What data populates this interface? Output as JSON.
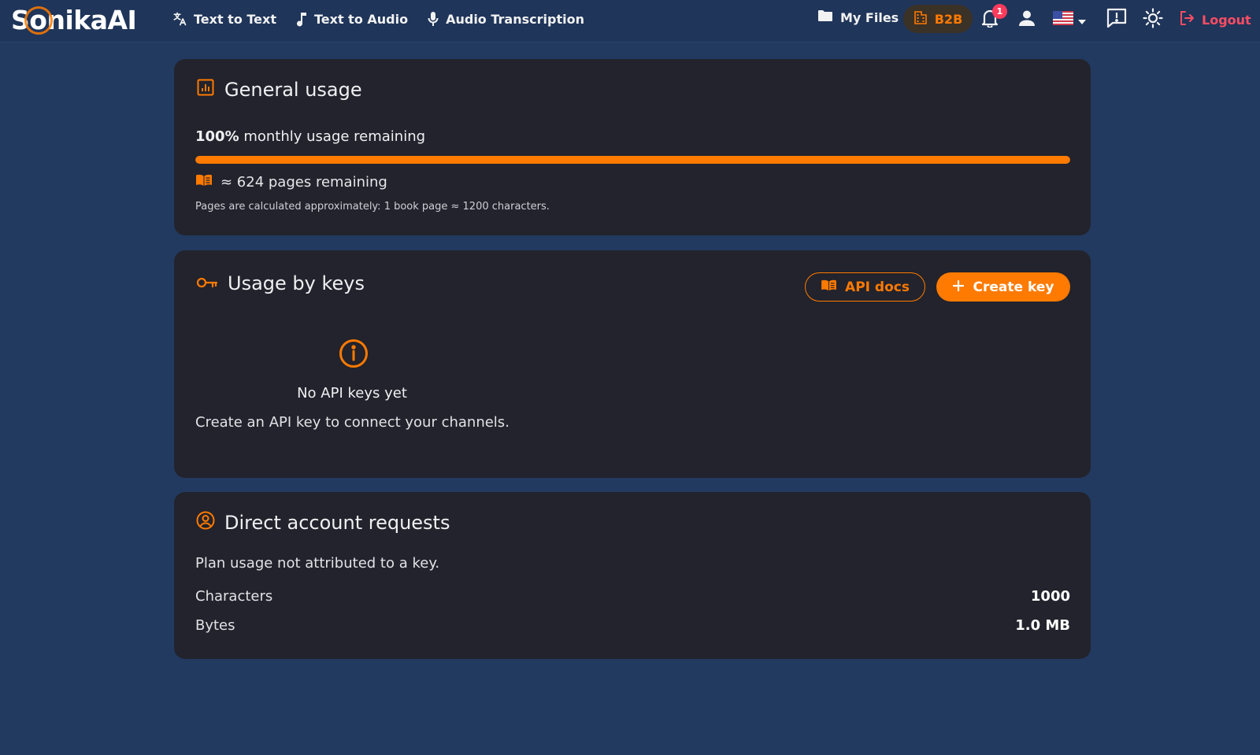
{
  "brand": {
    "name_prefix": "S",
    "name_o": "o",
    "name_rest": "nikaAI",
    "accent": "#ff7a00"
  },
  "nav": {
    "links": [
      {
        "label": "Text to Text",
        "icon": "translate-icon"
      },
      {
        "label": "Text to Audio",
        "icon": "music-note-icon"
      },
      {
        "label": "Audio Transcription",
        "icon": "microphone-icon"
      }
    ],
    "my_files": "My Files",
    "b2b": "B2B",
    "notification_count": "1",
    "logout": "Logout"
  },
  "general_usage": {
    "title": "General usage",
    "percent": "100%",
    "percent_text": " monthly usage remaining",
    "progress_fraction": 1.0,
    "pages_remaining": "≈ 624 pages remaining",
    "note": "Pages are calculated approximately: 1 book page ≈ 1200 characters."
  },
  "usage_by_keys": {
    "title": "Usage by keys",
    "api_docs": "API docs",
    "create_key": "Create key",
    "empty_title": "No API keys yet",
    "empty_desc": "Create an API key to connect your channels."
  },
  "direct_requests": {
    "title": "Direct account requests",
    "note": "Plan usage not attributed to a key.",
    "rows": [
      {
        "label": "Characters",
        "value": "1000"
      },
      {
        "label": "Bytes",
        "value": "1.0 MB"
      }
    ]
  }
}
